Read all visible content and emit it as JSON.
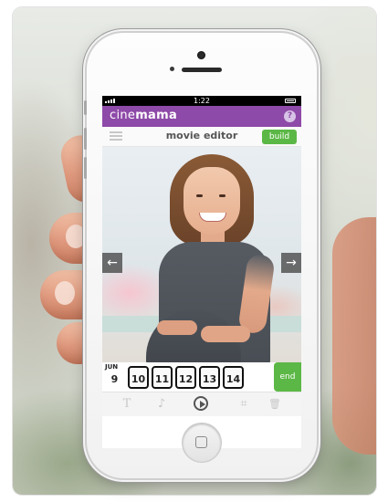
{
  "status_bar": {
    "time": "1:22"
  },
  "app": {
    "brand_light": "cine",
    "brand_bold": "mama",
    "help_label": "?"
  },
  "toolbar": {
    "title": "movie editor",
    "build_label": "build"
  },
  "viewer": {
    "prev_glyph": "←",
    "next_glyph": "→"
  },
  "timeline": {
    "month": "JUN",
    "days": [
      "9",
      "10",
      "11",
      "12",
      "13",
      "14"
    ],
    "end_label": "end"
  },
  "bottom_tools": {
    "text_glyph": "T",
    "music_glyph": "♪",
    "crop_glyph": "⌗",
    "trash_glyph": "🗑"
  },
  "colors": {
    "brand": "#8e4aa8",
    "accent": "#5cb846"
  }
}
